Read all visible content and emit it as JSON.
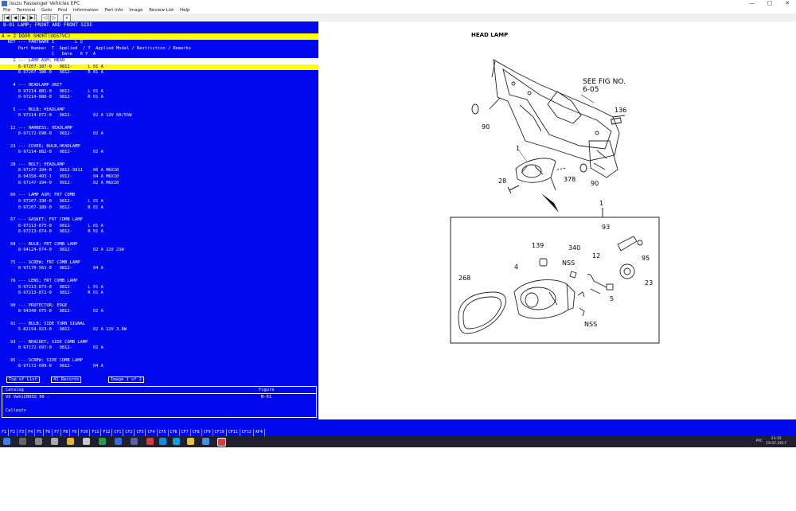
{
  "window": {
    "title": "Isuzu Passenger Vehicles EPC",
    "controls": [
      "—",
      "□",
      "✕"
    ]
  },
  "menu": [
    "File",
    "Terminal",
    "Goto",
    "Find",
    "Information",
    "Part Info",
    "Image",
    "Review List",
    "Help"
  ],
  "toolbar": [
    "|◀",
    "◀",
    "▶",
    "▶|",
    "◁",
    "▷",
    "⌕"
  ],
  "header": {
    "section": "B-01 LAMP; FRONT AND FRONT SIDE",
    "variant": "A = 2 DOOR SHORT(UGS7VC)"
  },
  "lines": [
    {
      "t": "   KEY --- PARTNAME I        L Q",
      "s": ""
    },
    {
      "t": "       Part Number  T  Applied  / T  Applied Model / Restriction / Remarks",
      "s": ""
    },
    {
      "t": "                    C   Date   R Y  A",
      "s": ""
    },
    {
      "t": "     1 --- LAMP ASM; HEAD",
      "s": "white"
    },
    {
      "t": "       8-97207-187-0   9812-      L 01 A",
      "s": "yellow"
    },
    {
      "t": "       8-97207-186-0   9812-      R 01 A",
      "s": ""
    },
    {
      "t": "",
      "s": ""
    },
    {
      "t": "     4 --- HEADLAMP UNIT",
      "s": ""
    },
    {
      "t": "       8-97214-881-0   9812-      L 01 A",
      "s": ""
    },
    {
      "t": "       8-97214-880-0   9812-      R 01 A",
      "s": ""
    },
    {
      "t": "",
      "s": ""
    },
    {
      "t": "     5 --- BULB; HEADLAMP",
      "s": ""
    },
    {
      "t": "       8-97214-872-0   9812-        02 A 12V 60/55W",
      "s": ""
    },
    {
      "t": "",
      "s": ""
    },
    {
      "t": "    12 --- HARNESS; HEADLAMP",
      "s": ""
    },
    {
      "t": "       8-97172-698-0   9812-        02 A",
      "s": ""
    },
    {
      "t": "",
      "s": ""
    },
    {
      "t": "    23 --- COVER; BULB,HEADLAMP",
      "s": ""
    },
    {
      "t": "       8-97214-882-0   9812-        02 A",
      "s": ""
    },
    {
      "t": "",
      "s": ""
    },
    {
      "t": "    28 --- BOLT; HEADLAMP",
      "s": ""
    },
    {
      "t": "       8-97147-194-0   9812-9911    06 A M6X10",
      "s": ""
    },
    {
      "t": "       8-94358-403-1   9912-        04 A M6X10",
      "s": ""
    },
    {
      "t": "       8-97147-194-0   9912-        02 A M6X10",
      "s": ""
    },
    {
      "t": "",
      "s": ""
    },
    {
      "t": "    60 --- LAMP ASM; FRT COMB",
      "s": ""
    },
    {
      "t": "       8-97207-190-0   9812-      L 01 A",
      "s": ""
    },
    {
      "t": "       8-97207-189-0   9812-      R 01 A",
      "s": ""
    },
    {
      "t": "",
      "s": ""
    },
    {
      "t": "    67 --- GASKET; FRT COMB LAMP",
      "s": ""
    },
    {
      "t": "       8-97213-875-0   9812-      L 01 A",
      "s": ""
    },
    {
      "t": "       8-97213-874-0   9812-      R 01 A",
      "s": ""
    },
    {
      "t": "",
      "s": ""
    },
    {
      "t": "    68 --- BULB; FRT COMB LAMP",
      "s": ""
    },
    {
      "t": "       8-94124-074-0   9812-        02 A 12V 21W",
      "s": ""
    },
    {
      "t": "",
      "s": ""
    },
    {
      "t": "    75 --- SCREW; FRT COMB LAMP",
      "s": ""
    },
    {
      "t": "       8-97170-561-0   9812-        04 A",
      "s": ""
    },
    {
      "t": "",
      "s": ""
    },
    {
      "t": "    76 --- LENS; FRT COMB LAMP",
      "s": ""
    },
    {
      "t": "       8-97213-873-0   9812-      L 01 A",
      "s": ""
    },
    {
      "t": "       8-97213-872-0   9812-      R 01 A",
      "s": ""
    },
    {
      "t": "",
      "s": ""
    },
    {
      "t": "    90 --- PROTECTOR; EDGE",
      "s": ""
    },
    {
      "t": "       8-94340-075-0   9812-        02 A",
      "s": ""
    },
    {
      "t": "",
      "s": ""
    },
    {
      "t": "    91 --- BULB; SIDE TURN SIGNAL",
      "s": ""
    },
    {
      "t": "       5-82194-023-0   9812-        02 A 12V 3.8W",
      "s": ""
    },
    {
      "t": "",
      "s": ""
    },
    {
      "t": "    93 --- BRACKET; SIDE COMB LAMP",
      "s": ""
    },
    {
      "t": "       8-97172-697-0   9812-        02 A",
      "s": ""
    },
    {
      "t": "",
      "s": ""
    },
    {
      "t": "    95 --- SCREW; SIDE COMB LAMP",
      "s": ""
    },
    {
      "t": "       8-97172-699-0   9812-        04 A",
      "s": ""
    }
  ],
  "status": {
    "top": "Top of List",
    "records": "41 Records",
    "image": "Image 1 of 2"
  },
  "catalog": {
    "col1": "Catalog",
    "col2": "Figure",
    "name": "VX VehiCROSS 99 -",
    "figure": "B-01",
    "callout": "Callout>"
  },
  "diagram": {
    "title": "HEAD LAMP",
    "see_fig": "SEE FIG NO.",
    "see_fig_num": "6-05",
    "labels": {
      "l136": "136",
      "l90a": "90",
      "l90b": "90",
      "l1a": "1",
      "l1b": "1",
      "l28": "28",
      "l378": "378",
      "l93": "93",
      "l95": "95",
      "l139": "139",
      "l340": "340",
      "l12": "12",
      "lnss1": "NSS",
      "lnss2": "NSS",
      "l4": "4",
      "l268": "268",
      "l5": "5",
      "l23": "23"
    }
  },
  "fkeys": [
    "F1",
    "F2",
    "F3",
    "F4",
    "F5",
    "F6",
    "F7",
    "F8",
    "F9",
    "F10",
    "F11",
    "F12",
    "CF1",
    "CF2",
    "CF3",
    "CF4",
    "CF5",
    "CF6",
    "CF7",
    "CF8",
    "CF9",
    "CF10",
    "CF11",
    "CF12",
    "AF4"
  ],
  "tray": {
    "lang": "РУС",
    "time": "23:35",
    "date": "19.07.2017"
  }
}
